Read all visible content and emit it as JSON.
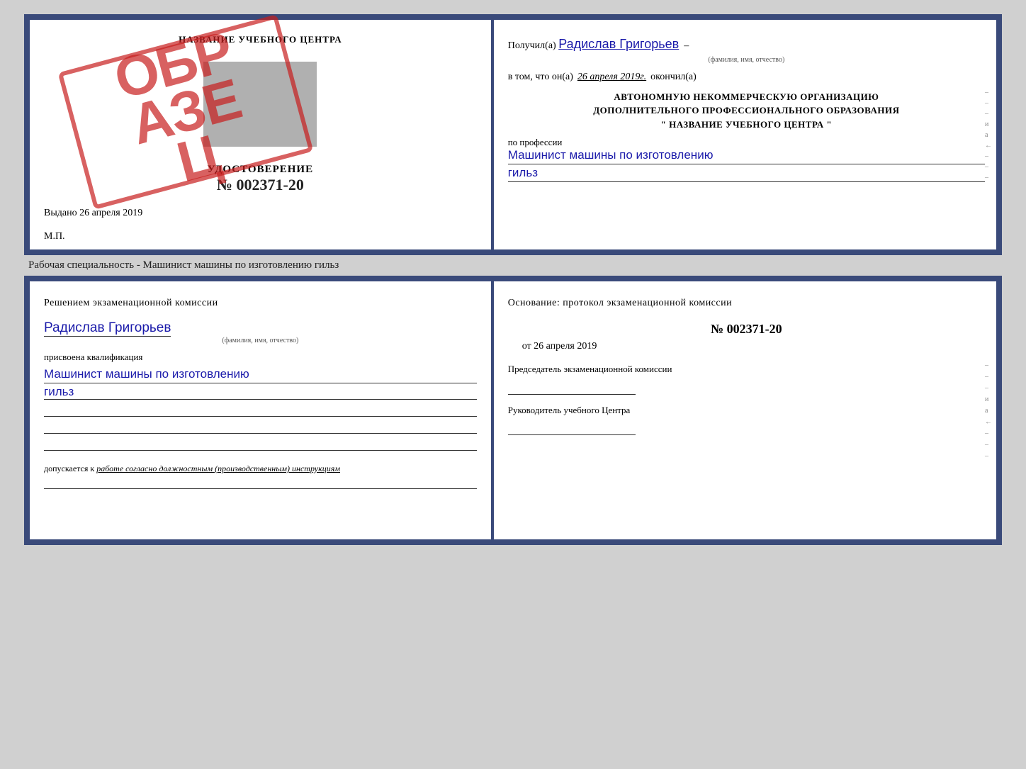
{
  "top_doc": {
    "left": {
      "title": "НАЗВАНИЕ УЧЕБНОГО ЦЕНТРА",
      "stamp": "ОБРА\nЗЕЦ",
      "udostoverenie_label": "УДОСТОВЕРЕНИЕ",
      "number": "№ 002371-20",
      "vydano_label": "Выдано",
      "vydano_date": "26 апреля 2019",
      "mp_label": "М.П."
    },
    "right": {
      "poluchil_label": "Получил(а)",
      "recipient_name": "Радислав Григорьев",
      "fio_label": "(фамилия, имя, отчество)",
      "vtom_label": "в том, что он(а)",
      "vtom_date": "26 апреля 2019г.",
      "okonchil_label": "окончил(а)",
      "org_line1": "АВТОНОМНУЮ НЕКОММЕРЧЕСКУЮ ОРГАНИЗАЦИЮ",
      "org_line2": "ДОПОЛНИТЕЛЬНОГО ПРОФЕССИОНАЛЬНОГО ОБРАЗОВАНИЯ",
      "org_name": "\"  НАЗВАНИЕ УЧЕБНОГО ЦЕНТРА  \"",
      "po_professii_label": "по профессии",
      "profession_line1": "Машинист машины по изготовлению",
      "profession_line2": "гильз",
      "side_marks": [
        "–",
        "–",
        "–",
        "и",
        "а",
        "←",
        "–",
        "–",
        "–"
      ]
    }
  },
  "specialty_label": "Рабочая специальность - Машинист машины по изготовлению гильз",
  "bottom_doc": {
    "left": {
      "komissia_text": "Решением  экзаменационной  комиссии",
      "name": "Радислав Григорьев",
      "fio_label": "(фамилия, имя, отчество)",
      "prisvoena_label": "присвоена квалификация",
      "kvalif_line1": "Машинист машины по изготовлению",
      "kvalif_line2": "гильз",
      "dopuskaetsya_prefix": "допускается к",
      "dopuskaetsya_text": "работе согласно должностным (производственным) инструкциям"
    },
    "right": {
      "osnovanie_title": "Основание: протокол экзаменационной  комиссии",
      "protocol_number": "№  002371-20",
      "ot_label": "от",
      "ot_date": "26 апреля 2019",
      "predsedatel_label": "Председатель экзаменационной комиссии",
      "rukovoditel_label": "Руководитель учебного Центра",
      "side_marks": [
        "–",
        "–",
        "–",
        "и",
        "а",
        "←",
        "–",
        "–",
        "–"
      ]
    }
  }
}
